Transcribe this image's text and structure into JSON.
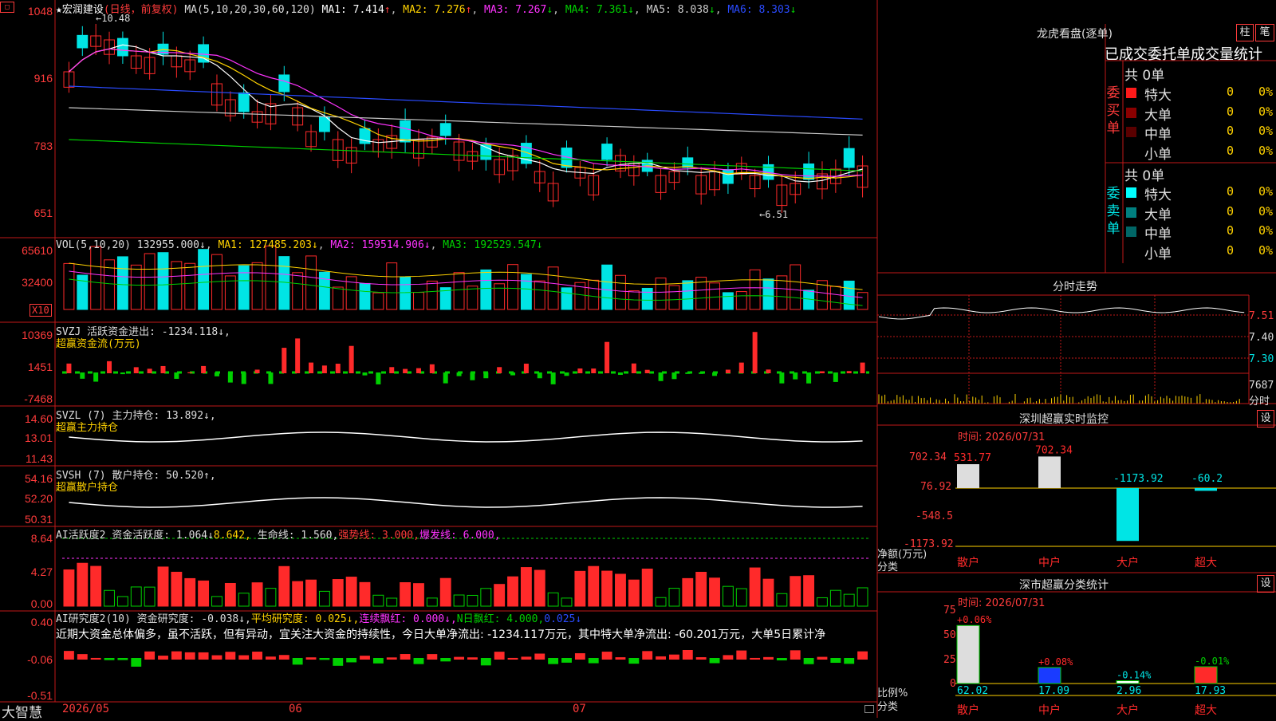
{
  "app": {
    "logo": "大智慧"
  },
  "colors": {
    "up": "#ff2a2a",
    "down": "#00e5e5",
    "grid": "#c01818",
    "ma1": "#ffffff",
    "ma2": "#ffd200",
    "ma3": "#ff33ff",
    "ma4": "#00d000",
    "ma5": "#cccccc",
    "ma6": "#2a4bff"
  },
  "kline": {
    "ylabels": [
      "1048",
      "916",
      "783",
      "651"
    ],
    "header": {
      "star": "★宏润建设",
      "mode": "(日线，前复权)",
      "ma_title": "MA(5,10,20,30,60,120)",
      "ma1": "MA1: 7.414",
      "ma2": "MA2: 7.276",
      "ma3": "MA3: 7.267",
      "ma4": "MA4: 7.361",
      "ma5": "MA5: 8.038",
      "ma6": "MA6: 8.303"
    },
    "high_label": "←10.48",
    "low_label": "←6.51"
  },
  "volume": {
    "ylabels": [
      "65610",
      "32400"
    ],
    "unit": "X10",
    "header": "VOL(5,10,20) 132955.000↓",
    "ma1": "MA1: 127485.203↓",
    "ma2": "MA2: 159514.906↓",
    "ma3": "MA3: 192529.547↓"
  },
  "svzj": {
    "ylabels": [
      "10369",
      "1451",
      "-7468"
    ],
    "header": "SVZJ  活跃资金进出: -1234.118↓,",
    "sub": "超赢资金流(万元)"
  },
  "svzl": {
    "ylabels": [
      "14.60",
      "13.01",
      "11.43"
    ],
    "header": "SVZL (7) 主力持仓: 13.892↓,",
    "sub": "超赢主力持仓"
  },
  "svsh": {
    "ylabels": [
      "54.16",
      "52.20",
      "50.31"
    ],
    "header": "SVSH (7) 散户持仓: 50.520↑,",
    "sub": "超赢散户持仓"
  },
  "ai1": {
    "ylabels": [
      "8.64",
      "4.27",
      "0.00"
    ],
    "header": "AI活跃度2 资金活跃度: 1.064↓",
    "v2": "8.642,",
    "life": "生命线: 1.560,",
    "strong": "强势线: 3.000,",
    "burst": "爆发线: 6.000,"
  },
  "ai2": {
    "ylabels": [
      "0.40",
      "-0.06",
      "-0.51"
    ],
    "header": "AI研究度2(10) 资金研究度: -0.038↓,",
    "avg": "平均研究度: 0.025↓,",
    "red": "连续飘红: 0.000↓,",
    "nred": "N日飘红: 4.000,",
    "last": "0.025↓",
    "comment": "近期大资金总体偏多，虽不活跃，但有异动，宜关注大资金的持续性，今日大单净流出: -1234.117万元，其中特大单净流出: -60.201万元，大单5日累计净"
  },
  "dates": [
    "2026/05",
    "06",
    "07"
  ],
  "lhb": {
    "title": "龙虎看盘(逐单)",
    "tab_bar": "柱",
    "tab_pen": "笔",
    "tabs": [
      "已成交",
      "委托单",
      "成交量统计"
    ],
    "buy": {
      "label": "委买单",
      "total": "共 0单",
      "rows": [
        {
          "name": "特大",
          "n": "0",
          "pct": "0%"
        },
        {
          "name": "大单",
          "n": "0",
          "pct": "0%"
        },
        {
          "name": "中单",
          "n": "0",
          "pct": "0%"
        },
        {
          "name": "小单",
          "n": "0",
          "pct": "0%"
        }
      ]
    },
    "sell": {
      "label": "委卖单",
      "total": "共 0单",
      "rows": [
        {
          "name": "特大",
          "n": "0",
          "pct": "0%"
        },
        {
          "name": "大单",
          "n": "0",
          "pct": "0%"
        },
        {
          "name": "中单",
          "n": "0",
          "pct": "0%"
        },
        {
          "name": "小单",
          "n": "0",
          "pct": "0%"
        }
      ]
    }
  },
  "intraday": {
    "title": "分时走势",
    "ylabels": [
      "7.51",
      "7.40",
      "7.30"
    ],
    "vol": "7687",
    "unit": "分时"
  },
  "sz_monitor": {
    "title": "深圳超赢实时监控",
    "set": "设",
    "time": "时间: 2026/07/31",
    "ylabels": [
      "702.34",
      "76.92",
      "-548.5",
      "-1173.92"
    ],
    "ytitle": "净额(万元)",
    "xtitle": "分类",
    "chart_data": {
      "type": "bar",
      "categories": [
        "散户",
        "中户",
        "大户",
        "超大"
      ],
      "values": [
        531.77,
        702.34,
        -1173.92,
        -60.2
      ],
      "value_labels": [
        "531.77",
        "702.34",
        "-1173.92",
        "-60.2"
      ],
      "ylim": [
        -1173.92,
        702.34
      ]
    }
  },
  "sz_class": {
    "title": "深市超赢分类统计",
    "set": "设",
    "time": "时间: 2026/07/31",
    "ylabels": [
      "75",
      "50",
      "25",
      "0"
    ],
    "ytitle": "比例%",
    "xtitle": "分类",
    "chart_data": {
      "type": "bar",
      "categories": [
        "散户",
        "中户",
        "大户",
        "超大"
      ],
      "values": [
        62.02,
        17.09,
        2.96,
        17.93
      ],
      "changes": [
        "+0.06%",
        "+0.08%",
        "-0.14%",
        "-0.01%"
      ],
      "ylim": [
        0,
        75
      ]
    }
  }
}
